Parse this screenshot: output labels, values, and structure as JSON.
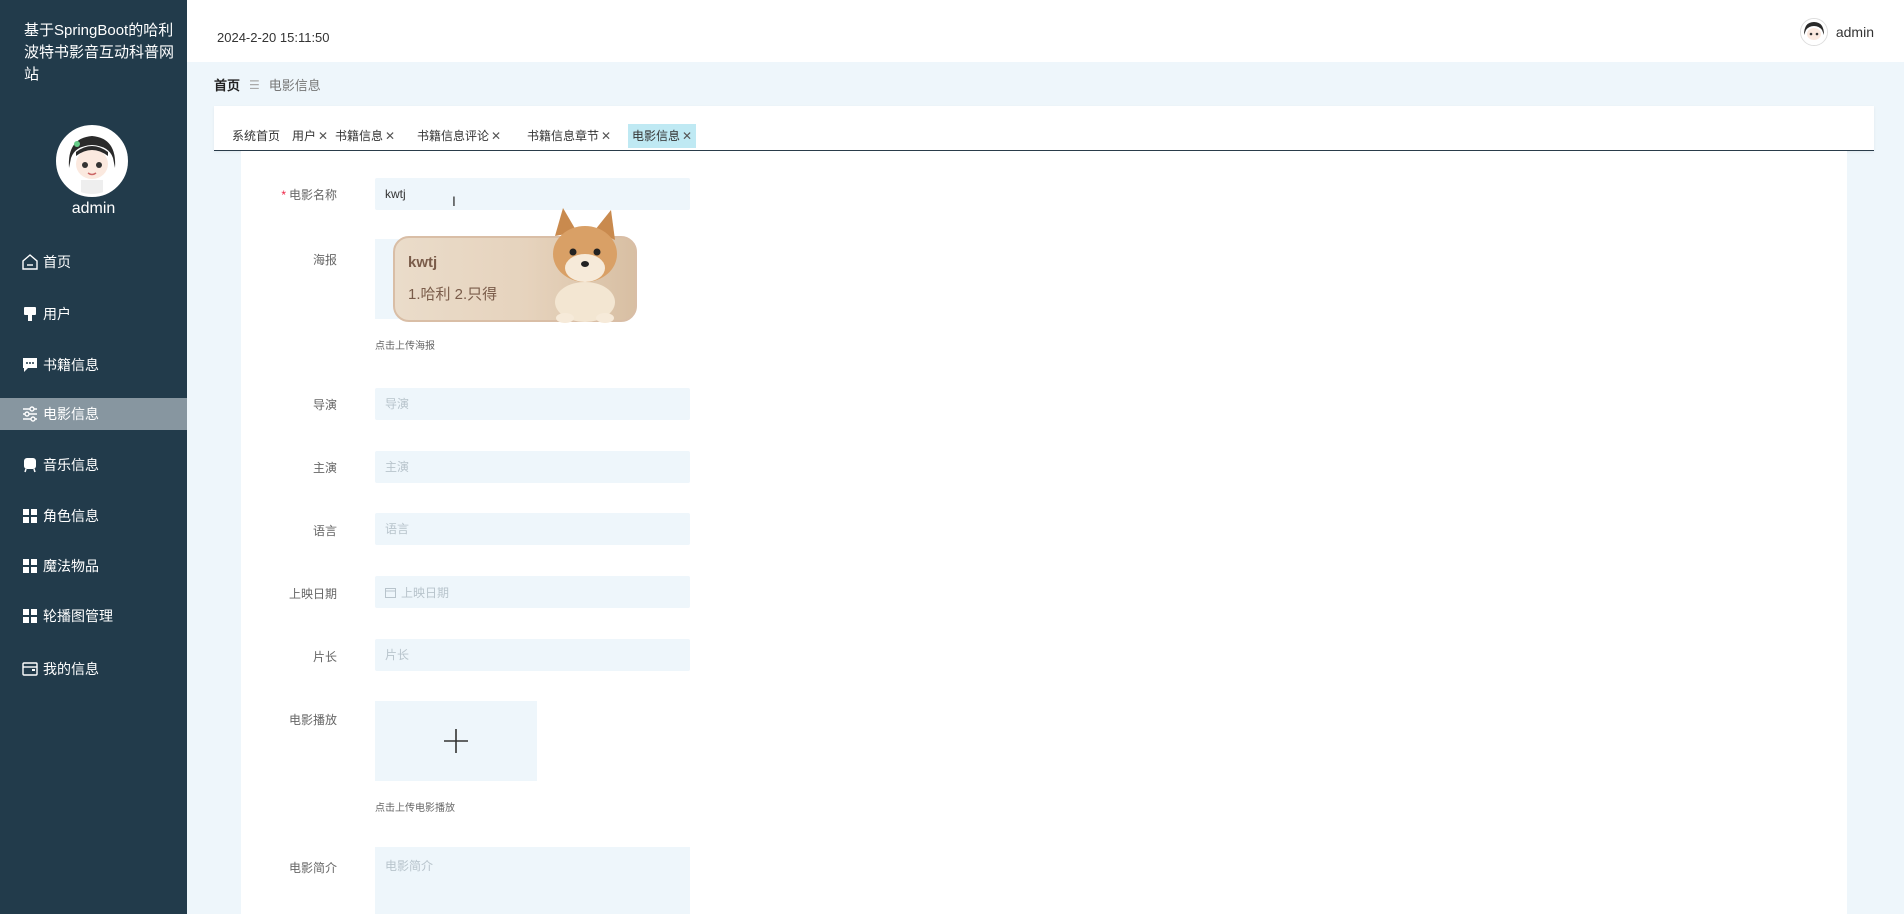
{
  "site": {
    "title": "基于SpringBoot的哈利波特书影音互动科普网站",
    "user": "admin"
  },
  "sidebar": {
    "items": [
      {
        "label": "首页",
        "icon": "home-icon"
      },
      {
        "label": "用户",
        "icon": "user-icon"
      },
      {
        "label": "书籍信息",
        "icon": "chat-icon"
      },
      {
        "label": "电影信息",
        "icon": "sliders-icon"
      },
      {
        "label": "音乐信息",
        "icon": "music-icon"
      },
      {
        "label": "角色信息",
        "icon": "grid-icon"
      },
      {
        "label": "魔法物品",
        "icon": "grid-icon"
      },
      {
        "label": "轮播图管理",
        "icon": "grid-icon"
      },
      {
        "label": "我的信息",
        "icon": "wallet-icon"
      }
    ],
    "active_index": 3
  },
  "header": {
    "datetime": "2024-2-20 15:11:50",
    "user": "admin"
  },
  "breadcrumb": {
    "home": "首页",
    "current": "电影信息"
  },
  "tabs": [
    {
      "label": "系统首页",
      "closable": false
    },
    {
      "label": "用户",
      "closable": true
    },
    {
      "label": "书籍信息",
      "closable": true
    },
    {
      "label": "书籍信息评论",
      "closable": true
    },
    {
      "label": "书籍信息章节",
      "closable": true
    },
    {
      "label": "电影信息",
      "closable": true,
      "active": true
    }
  ],
  "form": {
    "name": {
      "label": "电影名称",
      "value": "kwtj",
      "required": true
    },
    "poster": {
      "label": "海报",
      "hint": "点击上传海报"
    },
    "director": {
      "label": "导演",
      "placeholder": "导演"
    },
    "cast": {
      "label": "主演",
      "placeholder": "主演"
    },
    "language": {
      "label": "语言",
      "placeholder": "语言"
    },
    "release_date": {
      "label": "上映日期",
      "placeholder": "上映日期"
    },
    "duration": {
      "label": "片长",
      "placeholder": "片长"
    },
    "video": {
      "label": "电影播放",
      "hint": "点击上传电影播放"
    },
    "intro": {
      "label": "电影简介",
      "placeholder": "电影简介"
    }
  },
  "ime": {
    "composition": "kwtj",
    "candidates": "1.哈利  2.只得"
  },
  "colors": {
    "sidebar_bg": "#223b4b",
    "sidebar_active": "#8796a0",
    "main_bg": "#eef6fb",
    "tab_active": "#bfe9f3",
    "required": "#ee2244"
  }
}
